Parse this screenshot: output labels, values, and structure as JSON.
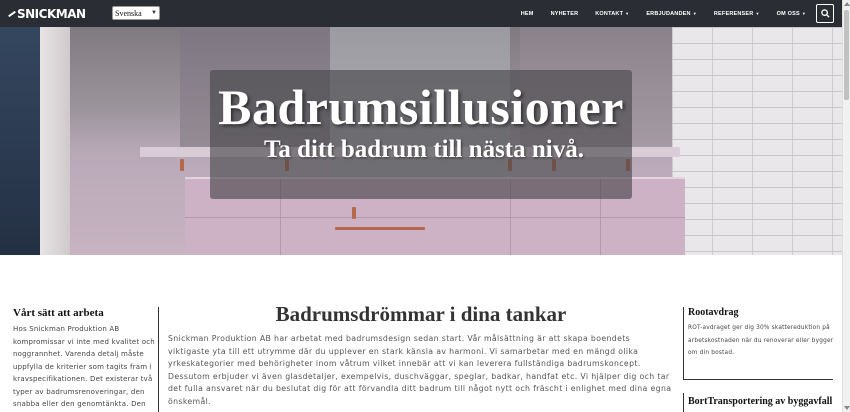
{
  "navbar": {
    "logo_text": "SNICKMAN",
    "language": "Svenska",
    "items": [
      {
        "label": "HEM",
        "dropdown": false
      },
      {
        "label": "NYHETER",
        "dropdown": false
      },
      {
        "label": "KONTAKT",
        "dropdown": true
      },
      {
        "label": "ERBJUDANDEN",
        "dropdown": true
      },
      {
        "label": "REFERENSER",
        "dropdown": true
      },
      {
        "label": "OM OSS",
        "dropdown": true
      }
    ],
    "search_icon": "search-icon"
  },
  "hero": {
    "title": "Badrumsillusioner",
    "subtitle": "Ta ditt badrum till nästa nivå."
  },
  "left": {
    "title": "Vårt sätt att arbeta",
    "text": "Hos Snickman Produktion AB kompromissar vi inte med kvalitet och noggrannhet. Varenda detalj måste uppfylla de kriterier som tagits fram i kravspecifikationen. Det existerar två typer av badrumsrenoveringar, den snabba eller den genomtänkta. Den"
  },
  "main": {
    "title": "Badrumsdrömmar i dina tankar",
    "text": "Snickman Produktion AB har arbetat med badrumsdesign sedan start. Vår målsättning är att skapa boendets viktigaste yta till ett utrymme där du upplever en stark känsla av harmoni. Vi samarbetar med en mängd olika yrkeskategorier med behörigheter inom våtrum vilket innebär att vi kan leverera fullständiga badrumskoncept. Dessutom erbjuder vi även glasdetaljer, exempelvis, duschväggar, speglar, badkar, handfat etc. Vi hjälper dig och tar det fulla ansvaret när du beslutat dig för att förvandla ditt badrum till något nytt och fräscht i enlighet med dina egna önskemål."
  },
  "right": {
    "title": "Rootavdrag",
    "text": "ROT-avdraget ger dig 30% skattereduktion på arbetskostnaden när du renoverar eller bygger om din bostad.",
    "title2": "BortTransportering av byggavfall"
  }
}
